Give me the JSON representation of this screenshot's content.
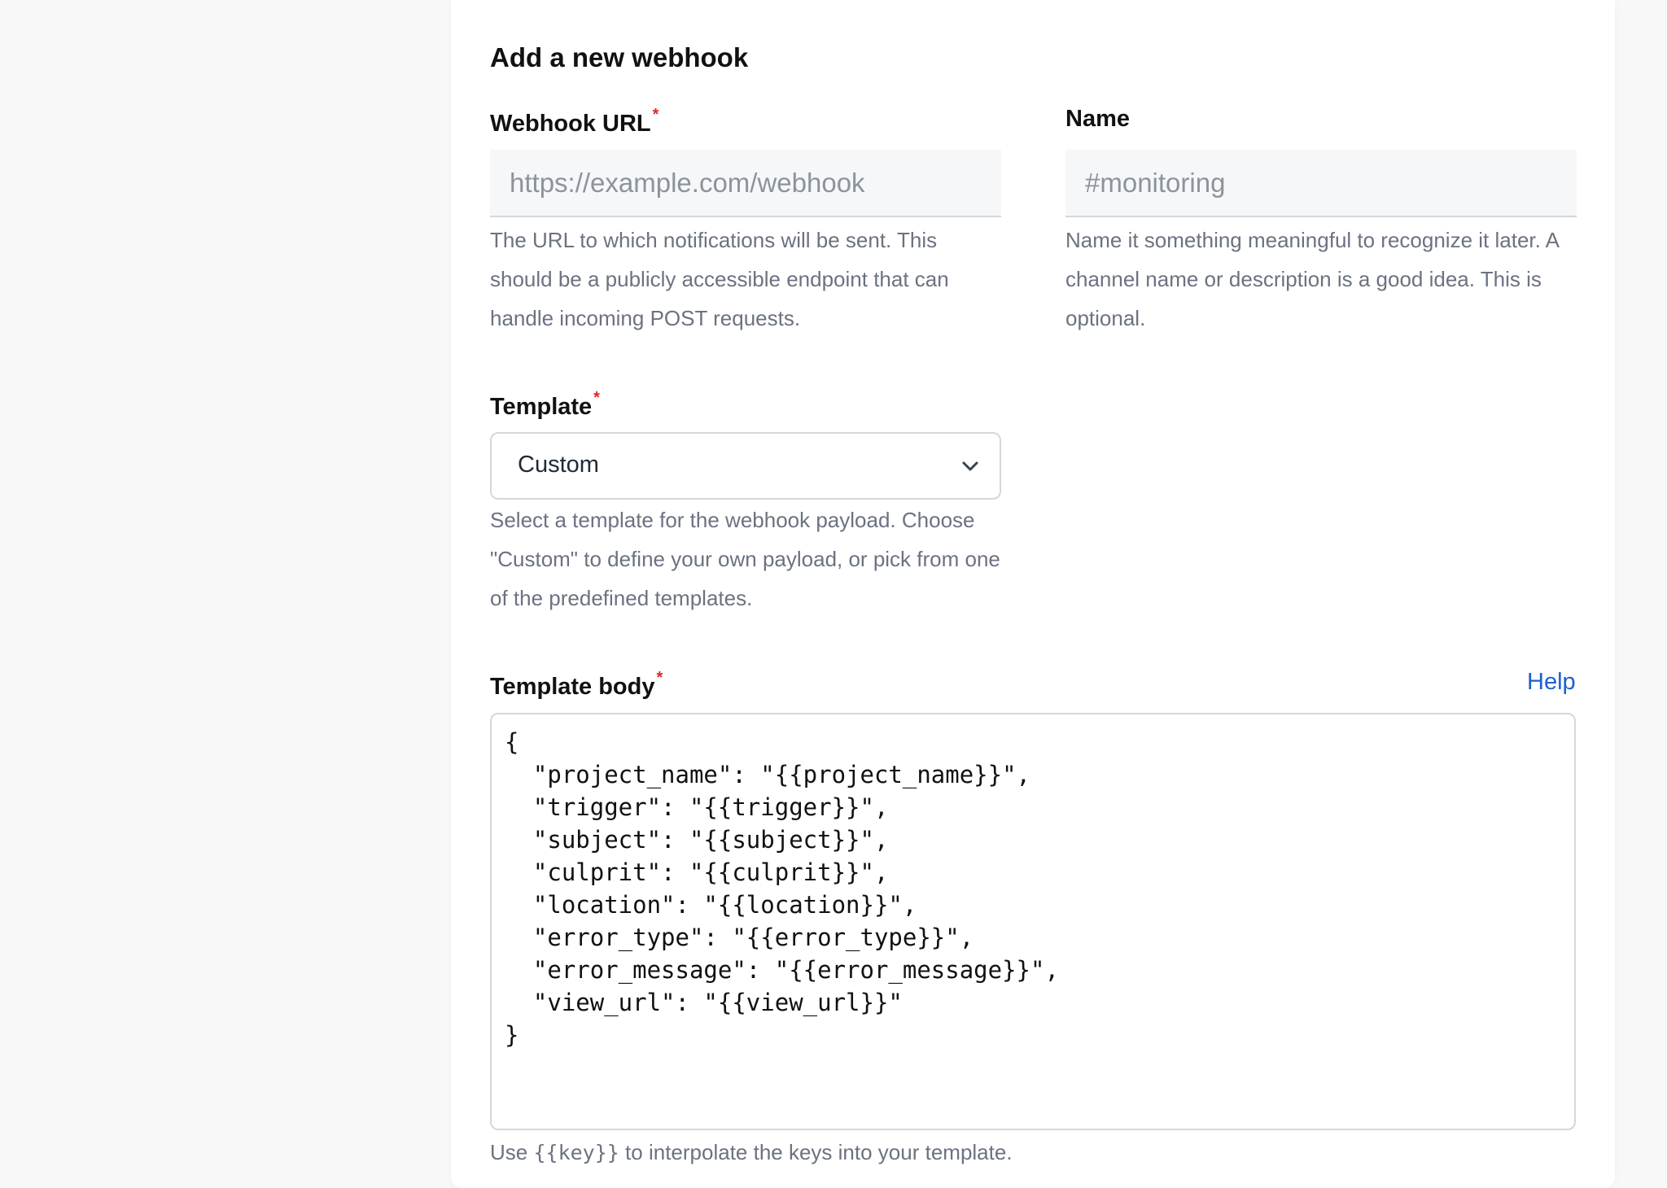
{
  "form": {
    "title": "Add a new webhook",
    "required_marker": "*",
    "webhook_url": {
      "label": "Webhook URL",
      "value": "",
      "placeholder": "https://example.com/webhook",
      "help": "The URL to which notifications will be sent. This should be a publicly accessible endpoint that can handle incoming POST requests."
    },
    "name": {
      "label": "Name",
      "value": "",
      "placeholder": "#monitoring",
      "help": "Name it something meaningful to recognize it later. A channel name or description is a good idea. This is optional."
    },
    "template": {
      "label": "Template",
      "selected": "Custom",
      "help": "Select a template for the webhook payload. Choose \"Custom\" to define your own payload, or pick from one of the predefined templates."
    },
    "template_body": {
      "label": "Template body",
      "help_link": "Help",
      "value": "{\n  \"project_name\": \"{{project_name}}\",\n  \"trigger\": \"{{trigger}}\",\n  \"subject\": \"{{subject}}\",\n  \"culprit\": \"{{culprit}}\",\n  \"location\": \"{{location}}\",\n  \"error_type\": \"{{error_type}}\",\n  \"error_message\": \"{{error_message}}\",\n  \"view_url\": \"{{view_url}}\"\n}",
      "hint_prefix": "Use ",
      "hint_code": "{{key}}",
      "hint_suffix": " to interpolate the keys into your template."
    }
  },
  "colors": {
    "required": "#e02424",
    "link": "#1d5fd1",
    "muted_text": "#6b7280"
  },
  "icons": {
    "select_chevron": "chevron-down-icon"
  }
}
